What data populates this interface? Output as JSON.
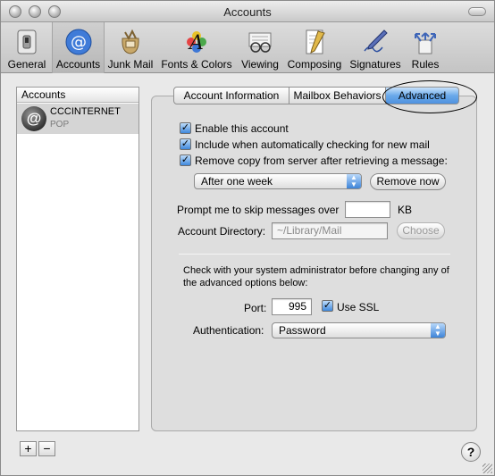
{
  "window": {
    "title": "Accounts"
  },
  "toolbar": {
    "items": [
      {
        "label": "General",
        "icon": "switch-icon"
      },
      {
        "label": "Accounts",
        "icon": "at-sign-icon",
        "selected": true
      },
      {
        "label": "Junk Mail",
        "icon": "junk-mail-bag-icon"
      },
      {
        "label": "Fonts & Colors",
        "icon": "font-palette-icon"
      },
      {
        "label": "Viewing",
        "icon": "glasses-icon"
      },
      {
        "label": "Composing",
        "icon": "pencil-paper-icon"
      },
      {
        "label": "Signatures",
        "icon": "pen-signature-icon"
      },
      {
        "label": "Rules",
        "icon": "rules-arrows-icon"
      }
    ]
  },
  "accounts": {
    "header": "Accounts",
    "list": [
      {
        "name": "CCCINTERNET",
        "type": "POP"
      }
    ],
    "add_label": "+",
    "remove_label": "−"
  },
  "tabs": [
    {
      "label": "Account Information"
    },
    {
      "label": "Mailbox Behaviors"
    },
    {
      "label": "Advanced",
      "selected": true
    }
  ],
  "advanced": {
    "enable_label": "Enable this account",
    "enable_checked": true,
    "include_label": "Include when automatically checking for new mail",
    "include_checked": true,
    "remove_copy_label": "Remove copy from server after retrieving a message:",
    "remove_copy_checked": true,
    "remove_after_value": "After one week",
    "remove_now_label": "Remove now",
    "prompt_label": "Prompt me to skip messages over",
    "prompt_value": "",
    "prompt_unit": "KB",
    "account_dir_label": "Account Directory:",
    "account_dir_value": "~/Library/Mail",
    "choose_label": "Choose",
    "admin_note_1": "Check with your system administrator before changing any of",
    "admin_note_2": "the advanced options below:",
    "port_label": "Port:",
    "port_value": "995",
    "use_ssl_label": "Use SSL",
    "use_ssl_checked": true,
    "auth_label": "Authentication:",
    "auth_value": "Password"
  },
  "help_label": "?",
  "colors": {
    "selected_tab": "#5b9be4",
    "toolbar": "#d0d0d0"
  }
}
